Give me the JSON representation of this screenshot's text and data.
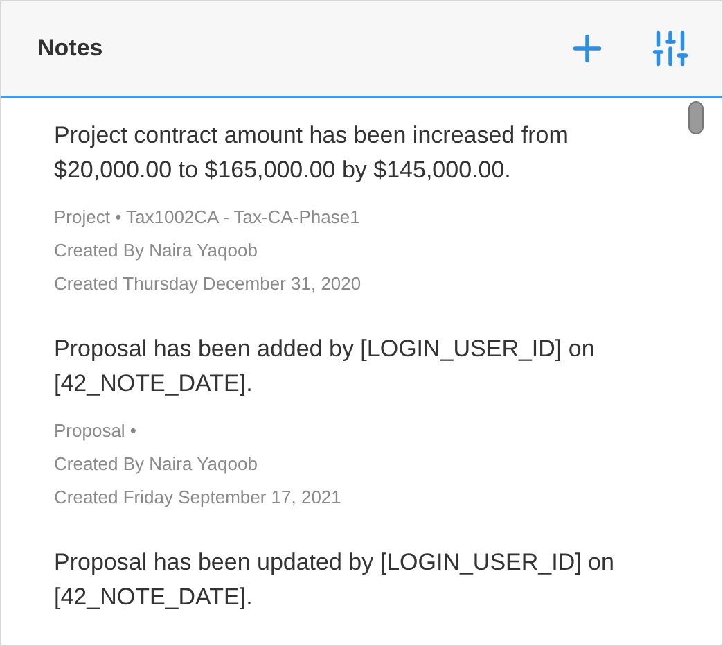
{
  "header": {
    "title": "Notes"
  },
  "notes": [
    {
      "text": "Project contract amount has been increased from $20,000.00 to $165,000.00 by $145,000.00.",
      "meta": [
        "Project • Tax1002CA - Tax-CA-Phase1",
        "Created By Naira Yaqoob",
        "Created Thursday December 31, 2020"
      ]
    },
    {
      "text": "Proposal has been added by [LOGIN_USER_ID] on [42_NOTE_DATE].",
      "meta": [
        "Proposal •",
        "Created By Naira Yaqoob",
        "Created Friday September 17, 2021"
      ]
    },
    {
      "text": "Proposal has been updated by [LOGIN_USER_ID] on [42_NOTE_DATE]."
    }
  ]
}
